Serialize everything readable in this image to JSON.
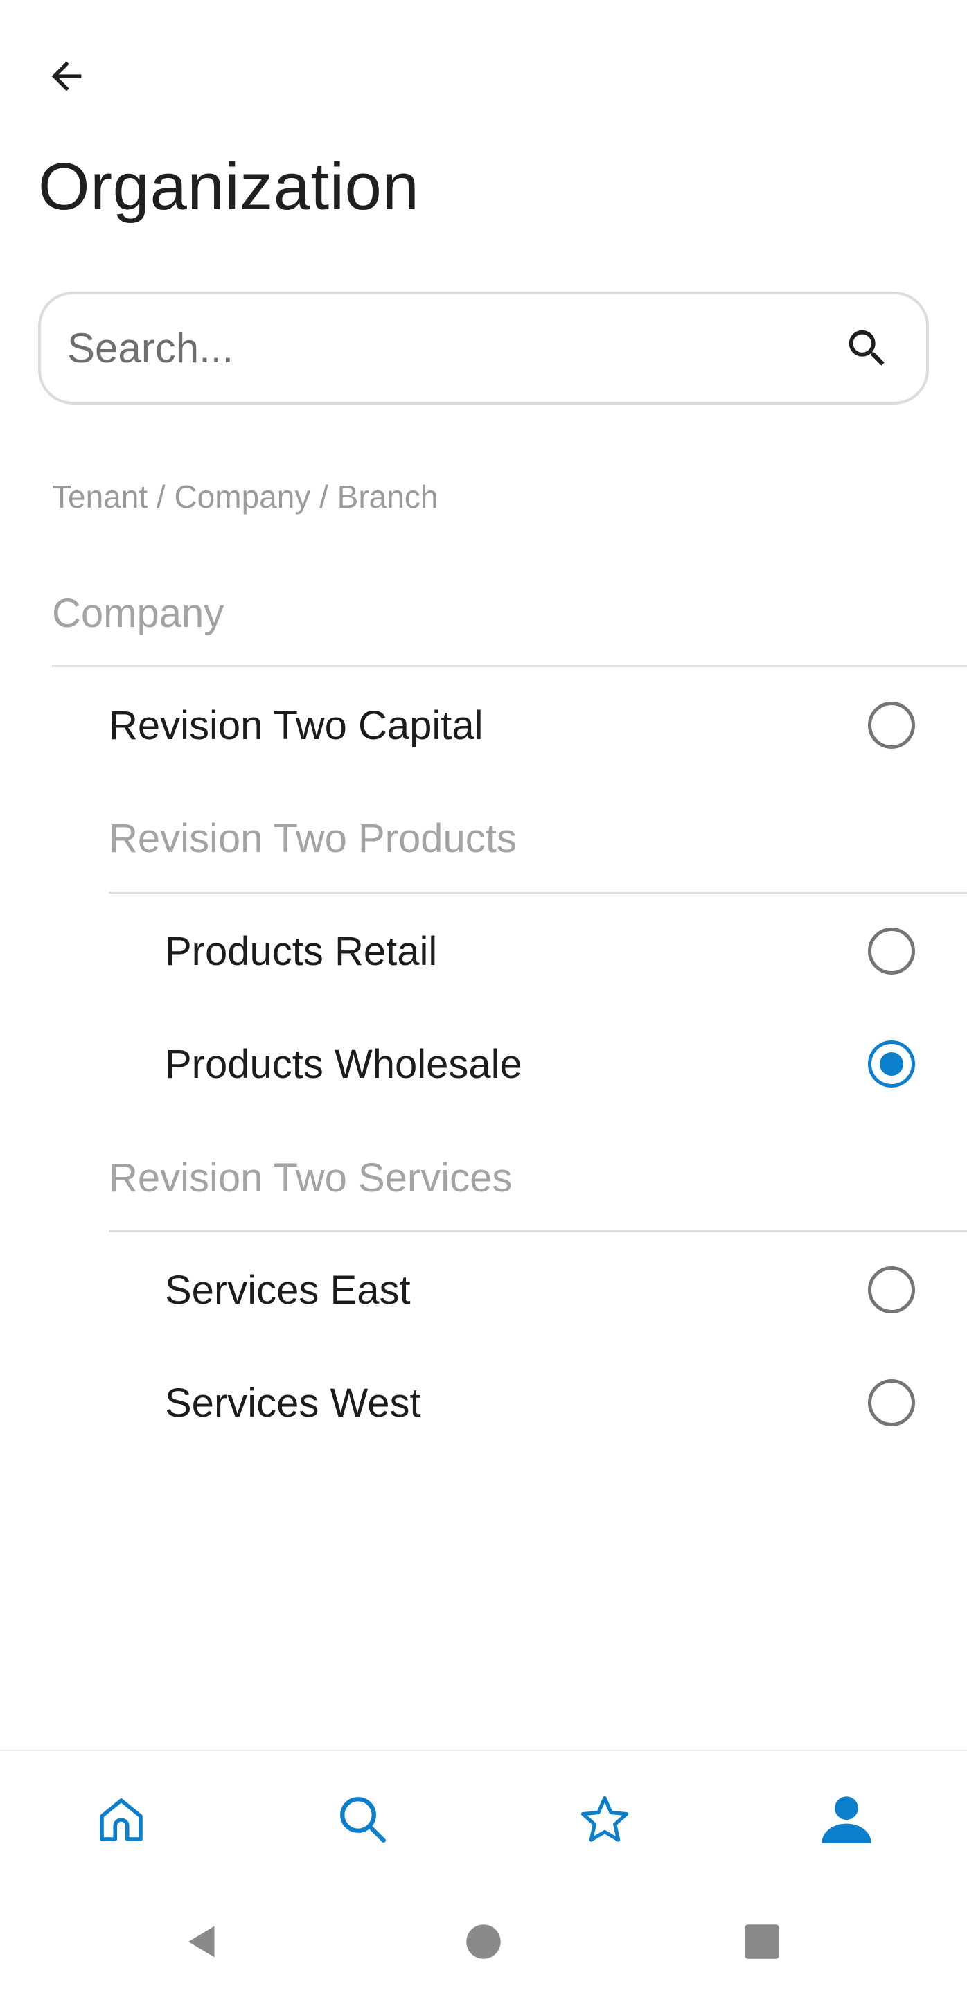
{
  "header": {
    "back_icon": "arrow-left-icon",
    "title": "Organization"
  },
  "search": {
    "placeholder": "Search...",
    "value": "",
    "icon": "search-icon"
  },
  "breadcrumb": "Tenant / Company / Branch",
  "tree": {
    "company_header": "Company",
    "items": [
      {
        "label": "Revision Two Capital",
        "selected": false
      },
      {
        "group": "Revision Two Products"
      },
      {
        "label": "Products Retail",
        "selected": false
      },
      {
        "label": "Products Wholesale",
        "selected": true
      },
      {
        "group": "Revision Two Services"
      },
      {
        "label": "Services East",
        "selected": false
      },
      {
        "label": "Services West",
        "selected": false
      }
    ]
  },
  "bottom_nav": [
    {
      "name": "home",
      "icon": "home-icon",
      "active": false
    },
    {
      "name": "search",
      "icon": "search-icon",
      "active": false
    },
    {
      "name": "favorites",
      "icon": "star-icon",
      "active": false
    },
    {
      "name": "profile",
      "icon": "person-icon",
      "active": true
    }
  ],
  "colors": {
    "accent": "#0b7fcc",
    "muted_text": "#a3a3a3",
    "divider": "#dedede",
    "radio_unchecked": "#757575"
  }
}
